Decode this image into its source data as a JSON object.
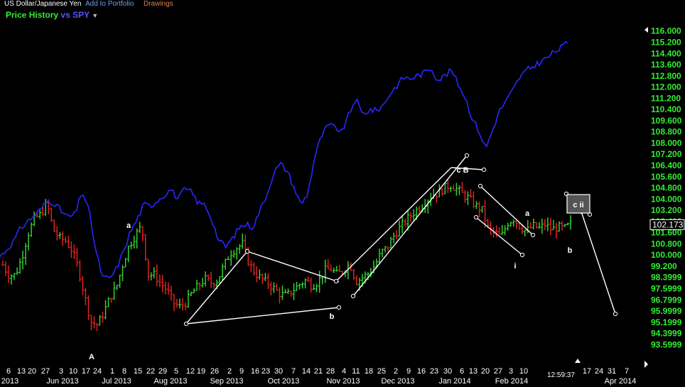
{
  "header": {
    "instrument": "US Dollar/Japanese Yen",
    "add_portfolio": "Add to Portfolio",
    "drawings": "Drawings",
    "price_history": "Price History",
    "vs": "vs",
    "compare_symbol": "SPY",
    "dropdown_arrow": "▼"
  },
  "colors": {
    "background": "#000000",
    "up_bar": "#33dd33",
    "down_bar": "#ee2222",
    "compare_line": "#2828ff",
    "price_axis": "#33ee33",
    "date_axis": "#ffffff",
    "annotation": "#ffffff"
  },
  "clock": "12:59:37",
  "last_price": "102.173",
  "chart_data": {
    "type": "line",
    "title": "US Dollar/Japanese Yen",
    "y_axis": {
      "side": "right",
      "ylim": [
        92.96,
        116.29
      ],
      "ticks": [
        "116.000",
        "115.200",
        "114.400",
        "113.600",
        "112.800",
        "112.000",
        "111.200",
        "110.400",
        "109.600",
        "108.800",
        "108.000",
        "107.200",
        "106.400",
        "105.600",
        "104.800",
        "104.000",
        "103.200",
        "102.400",
        "101.600",
        "100.800",
        "100.000",
        "99.200",
        "98.3999",
        "97.5999",
        "96.7999",
        "95.9999",
        "95.1999",
        "94.3999",
        "93.5999"
      ]
    },
    "x_axis": {
      "day_ticks": [
        "6",
        "13",
        "20",
        "27",
        "3",
        "10",
        "17",
        "24",
        "1",
        "8",
        "15",
        "22",
        "29",
        "5",
        "12",
        "19",
        "26",
        "2",
        "9",
        "16",
        "23",
        "30",
        "7",
        "14",
        "21",
        "28",
        "4",
        "11",
        "18",
        "25",
        "2",
        "9",
        "16",
        "23",
        "30",
        "6",
        "13",
        "20",
        "27",
        "3",
        "10",
        "17",
        "24",
        "31",
        "7"
      ],
      "month_labels": [
        "2013",
        "Jun 2013",
        "Jul 2013",
        "Aug 2013",
        "Sep 2013",
        "Oct 2013",
        "Nov 2013",
        "Dec 2013",
        "Jan 2014",
        "Feb 2014",
        "Apr 2014"
      ]
    },
    "series": [
      {
        "name": "US Dollar/Japanese Yen",
        "style": "ohlc",
        "close_path": [
          99.3,
          98.5,
          98.6,
          99.8,
          101.5,
          102.6,
          102.9,
          103.7,
          101.8,
          101.2,
          101.0,
          100.3,
          99.0,
          97.0,
          95.2,
          95.0,
          95.9,
          97.0,
          97.7,
          99.3,
          100.7,
          101.4,
          102.1,
          98.6,
          98.6,
          98.0,
          97.5,
          96.6,
          96.3,
          96.6,
          97.3,
          97.8,
          98.3,
          98.0,
          98.2,
          99.2,
          100.1,
          100.5,
          100.8,
          99.4,
          98.7,
          98.3,
          98.0,
          97.6,
          97.2,
          97.1,
          97.5,
          97.9,
          98.2,
          97.8,
          98.1,
          98.9,
          99.0,
          98.6,
          98.9,
          99.4,
          98.1,
          98.4,
          98.7,
          99.3,
          100.2,
          100.6,
          101.4,
          102.0,
          102.5,
          103.0,
          103.4,
          103.8,
          104.3,
          104.4,
          104.8,
          105.0,
          104.7,
          104.3,
          104.0,
          103.5,
          103.2,
          101.8,
          101.6,
          101.3,
          102.3,
          102.6,
          102.0,
          101.7,
          102.1,
          101.9,
          102.2,
          101.8,
          102.0,
          101.9,
          102.2
        ],
        "daily_range": 0.9
      },
      {
        "name": "SPY",
        "style": "line",
        "path": [
          99.9,
          100.4,
          101.0,
          101.9,
          102.4,
          102.8,
          103.3,
          103.9,
          103.7,
          103.1,
          102.7,
          102.9,
          104.6,
          103.2,
          100.3,
          98.4,
          98.3,
          99.0,
          100.2,
          101.6,
          102.5,
          103.6,
          103.5,
          103.9,
          104.3,
          104.7,
          104.0,
          104.7,
          104.5,
          103.7,
          103.6,
          102.5,
          101.0,
          100.6,
          101.2,
          102.0,
          102.2,
          102.0,
          103.2,
          104.3,
          105.9,
          106.5,
          106.0,
          104.8,
          103.6,
          104.4,
          107.0,
          108.5,
          109.3,
          109.1,
          108.8,
          110.0,
          111.2,
          110.0,
          110.4,
          110.3,
          110.7,
          111.5,
          112.1,
          112.7,
          112.6,
          112.8,
          113.0,
          113.4,
          112.5,
          112.8,
          113.2,
          112.2,
          111.3,
          109.8,
          108.9,
          107.6,
          108.9,
          110.3,
          111.0,
          111.8,
          112.7,
          113.2,
          113.5,
          113.8,
          114.1,
          114.5,
          114.8,
          115.2
        ]
      }
    ],
    "annotations": [
      {
        "text": "A",
        "type": "wave-label"
      },
      {
        "text": "a",
        "type": "wave-label"
      },
      {
        "text": "b",
        "type": "wave-label"
      },
      {
        "text": "c B",
        "type": "wave-label"
      },
      {
        "text": "i",
        "type": "wave-label"
      },
      {
        "text": "a",
        "type": "wave-label"
      },
      {
        "text": "b",
        "type": "wave-label"
      },
      {
        "text": "c ii",
        "type": "boxed-label"
      }
    ]
  }
}
